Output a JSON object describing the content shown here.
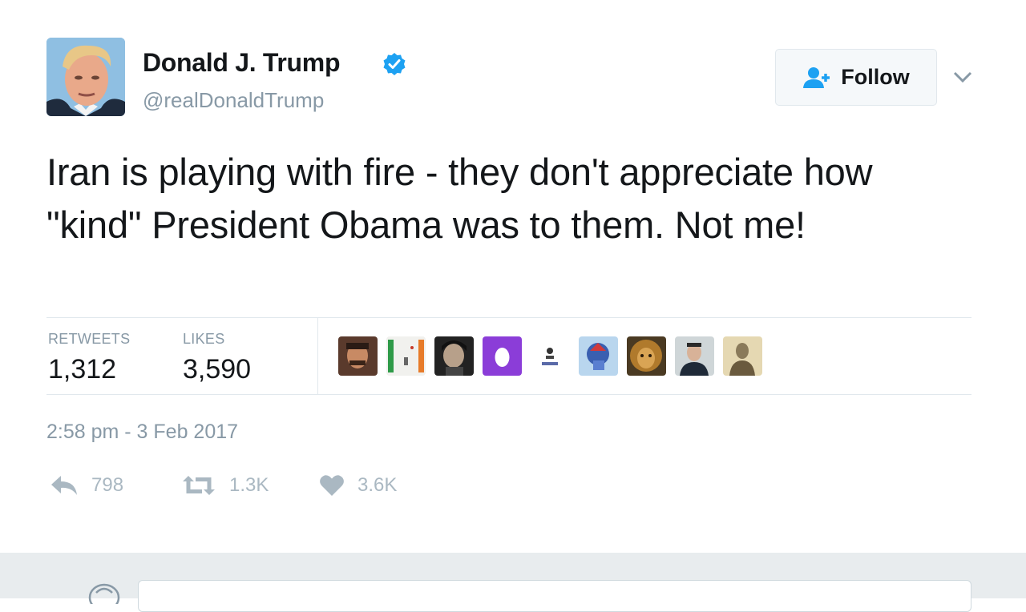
{
  "user": {
    "name": "Donald J. Trump",
    "handle": "@realDonaldTrump",
    "verified": true
  },
  "follow": {
    "label": "Follow",
    "icon": "person-plus-icon"
  },
  "tweet": {
    "text": "Iran is playing with fire - they don't appreciate how \"kind\" President Obama was to them. Not me!",
    "timestamp": "2:58 pm - 3 Feb 2017"
  },
  "stats": {
    "retweets_label": "RETWEETS",
    "retweets_count": "1,312",
    "likes_label": "LIKES",
    "likes_count": "3,590"
  },
  "actions": {
    "reply_count": "798",
    "retweet_count": "1.3K",
    "like_count": "3.6K"
  },
  "colors": {
    "accent": "#1da1f2",
    "muted": "#8899a6",
    "text": "#14171a"
  }
}
